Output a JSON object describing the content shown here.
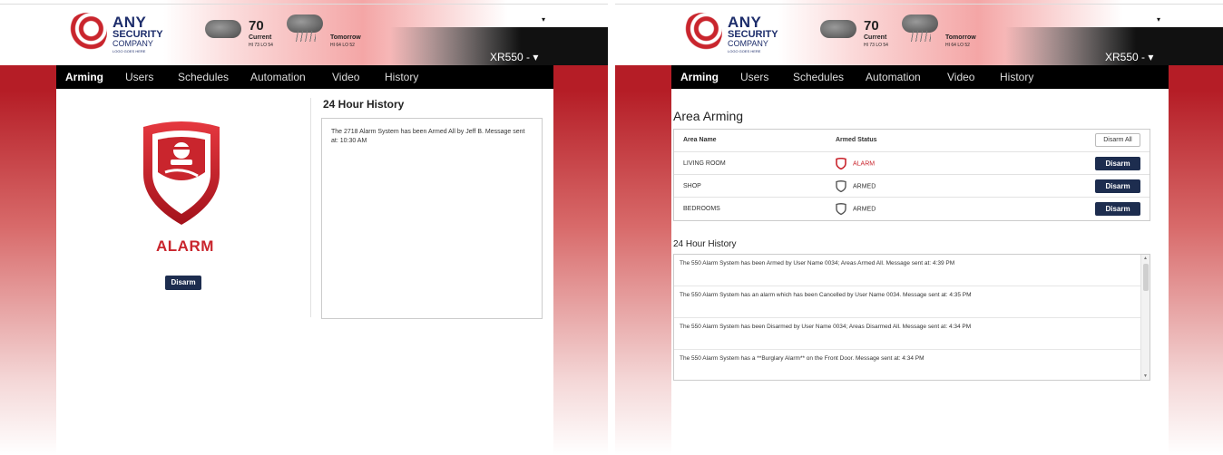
{
  "colors": {
    "brand_red": "#c9252d",
    "nav_bg": "#000000",
    "button_navy": "#1d2d4f",
    "logo_navy": "#1d2d6b"
  },
  "header": {
    "logo": {
      "any": "ANY",
      "security": "SECURITY",
      "company": "COMPANY",
      "tagline": "LOGO GOES HERE"
    },
    "weather": {
      "temp": "70",
      "current_label": "Current",
      "current_hilo": "HI 73  LO 54",
      "tomorrow_label": "Tomorrow",
      "tomorrow_hilo": "HI 64  LO 52",
      "current_icon": "cloud-icon",
      "tomorrow_icon": "rain-cloud-icon"
    },
    "device": "XR550 - ▾",
    "top_caret": "▾"
  },
  "nav": {
    "items": [
      "Arming",
      "Users",
      "Schedules",
      "Automation",
      "Video",
      "History"
    ],
    "active": "Arming"
  },
  "left_screen": {
    "status_label": "ALARM",
    "disarm_button": "Disarm",
    "history_title": "24 Hour History",
    "history_text": "The 2718 Alarm System has been Armed All by Jeff B. Message sent at: 10:30 AM"
  },
  "right_screen": {
    "area_title": "Area Arming",
    "table": {
      "col_area": "Area Name",
      "col_status": "Armed Status",
      "disarm_all": "Disarm All",
      "rows": [
        {
          "name": "LIVING ROOM",
          "status": "ALARM",
          "button": "Disarm"
        },
        {
          "name": "SHOP",
          "status": "ARMED",
          "button": "Disarm"
        },
        {
          "name": "BEDROOMS",
          "status": "ARMED",
          "button": "Disarm"
        }
      ]
    },
    "history_title": "24 Hour History",
    "history": [
      "The 550 Alarm System has been Armed by User Name 0034; Areas Armed All. Message sent at: 4:39 PM",
      "The 550 Alarm System has an alarm which has been Cancelled by User Name 0034. Message sent at: 4:35 PM",
      "The 550 Alarm System has been Disarmed by User Name 0034; Areas Disarmed All. Message sent at: 4:34 PM",
      "The 550 Alarm System has a **Burglary Alarm** on the Front Door. Message sent at: 4:34 PM"
    ]
  }
}
